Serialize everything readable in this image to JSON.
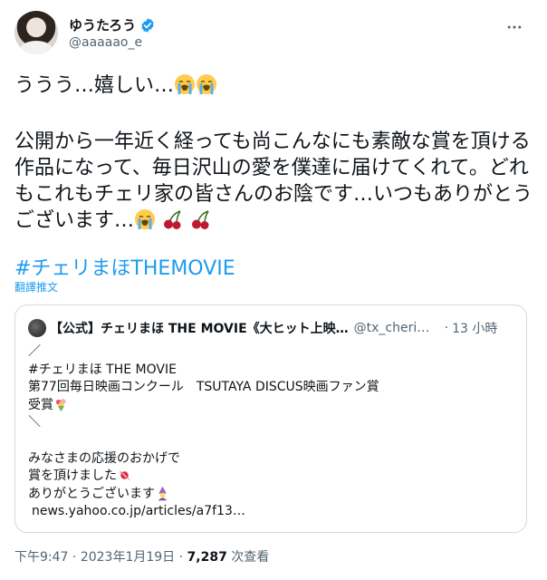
{
  "author": {
    "display_name": "ゆうたろう",
    "handle": "@aaaaao_e"
  },
  "tweet": {
    "line1": "ううう…嬉しい…",
    "paragraph2": "公開から一年近く経っても尚こんなにも素敵な賞を頂ける作品になって、毎日沢山の愛を僕達に届けてくれて。どれもこれもチェリ家の皆さんのお陰です…いつもありがとうございます…",
    "hashtag": "#チェリまほTHEMOVIE",
    "translate_label": "翻譯推文"
  },
  "quote": {
    "name": "【公式】チェリまほ THE MOVIE《大ヒット上映…",
    "handle": "@tx_cherim…",
    "dot": "·",
    "time": "13 小時",
    "lines": {
      "l1": "／",
      "l2": "#チェリまほ THE MOVIE",
      "l3": "第77回毎日映画コンクール　TSUTAYA DISCUS映画ファン賞",
      "l4": "受賞",
      "l5": "＼",
      "l6": "",
      "l7": "みなさまの応援のおかげで",
      "l8": "賞を頂けました",
      "l9": "ありがとうございます",
      "l10": "news.yahoo.co.jp/articles/a7f13…"
    }
  },
  "meta": {
    "time": "下午9:47",
    "sep1": " · ",
    "date": "2023年1月19日",
    "sep2": " · ",
    "views_count": "7,287",
    "views_label": " 次查看"
  },
  "colors": {
    "accent": "#1d9bf0",
    "secondary_text": "#536471",
    "border": "#cfd9de"
  },
  "icons": {
    "verified": "verified-badge-icon",
    "more": "more-options-icon",
    "crying": "loudly-crying-face-icon",
    "cherries": "cherries-icon"
  }
}
